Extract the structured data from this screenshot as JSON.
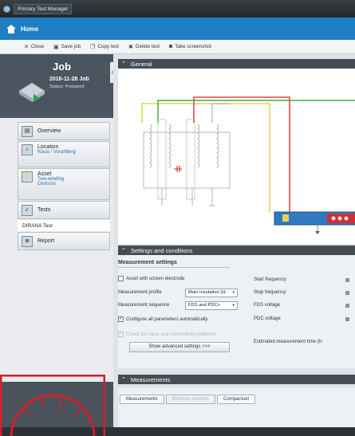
{
  "window": {
    "title": "Primary Test Manager"
  },
  "home": {
    "label": "Home"
  },
  "toolbar": {
    "close": "Close",
    "save_job": "Save job",
    "copy_test": "Copy test",
    "delete_test": "Delete test",
    "take_screenshot": "Take screenshot"
  },
  "job": {
    "heading": "Job",
    "name": "2016-11-28 Job",
    "status": "Status: Prepared"
  },
  "nav": {
    "overview": "Overview",
    "location": "Location",
    "location_sub": "Klaus / Vorarlberg",
    "asset": "Asset",
    "asset_sub1": "Two-winding",
    "asset_sub2": "Omicron",
    "tests": "Tests",
    "dirana_test": "DIRANA Test",
    "report": "Report"
  },
  "general": {
    "header": "General"
  },
  "settings": {
    "header": "Settings and conditions",
    "measurement_settings": "Measurement settings",
    "asset_screen_electrode": "Asset with screen electrode",
    "measurement_profile_label": "Measurement profile",
    "measurement_profile_value": "Main insulation (H-",
    "measurement_sequence_label": "Measurement sequence",
    "measurement_sequence_value": "FDS and PDC+",
    "configure_auto": "Configure all parameters automatically",
    "check_noise": "Check for noise and connectivity problems",
    "show_advanced": "Show advanced settings >>>",
    "start_frequency": "Start frequency",
    "stop_frequency": "Stop frequency",
    "fds_voltage": "FDS voltage",
    "pdc_voltage": "PDC voltage",
    "estimated_time": "Estimated measurement time (h:"
  },
  "measurements": {
    "header": "Measurements",
    "tabs": [
      "Measurements",
      "Moisture analysis",
      "Comparison"
    ]
  },
  "colors": {
    "accent_blue": "#1f7fc4",
    "header_dark": "#444c54",
    "sidebar_dark": "#4a5560",
    "highlight_red": "#d0202a"
  }
}
